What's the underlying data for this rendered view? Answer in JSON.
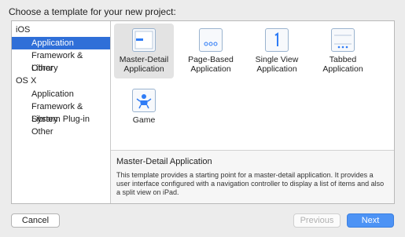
{
  "prompt": "Choose a template for your new project:",
  "sidebar": {
    "sections": [
      {
        "header": "iOS",
        "items": [
          "Application",
          "Framework & Library",
          "Other"
        ]
      },
      {
        "header": "OS X",
        "items": [
          "Application",
          "Framework & Library",
          "System Plug-in",
          "Other"
        ]
      }
    ],
    "selected": "Application"
  },
  "templates": [
    {
      "label": "Master-Detail Application",
      "icon": "master-detail-icon",
      "selected": true
    },
    {
      "label": "Page-Based Application",
      "icon": "page-based-icon",
      "selected": false
    },
    {
      "label": "Single View Application",
      "icon": "single-view-icon",
      "selected": false
    },
    {
      "label": "Tabbed Application",
      "icon": "tabbed-icon",
      "selected": false
    },
    {
      "label": "Game",
      "icon": "game-icon",
      "selected": false
    }
  ],
  "description": {
    "title": "Master-Detail Application",
    "text": "This template provides a starting point for a master-detail application. It provides a user interface configured with a navigation controller to display a list of items and also a split view on iPad."
  },
  "buttons": {
    "cancel": "Cancel",
    "previous": "Previous",
    "next": "Next"
  },
  "colors": {
    "selection": "#2f6fd8",
    "primary_button": "#4d93f5",
    "icon_accent": "#2f7cf6"
  }
}
